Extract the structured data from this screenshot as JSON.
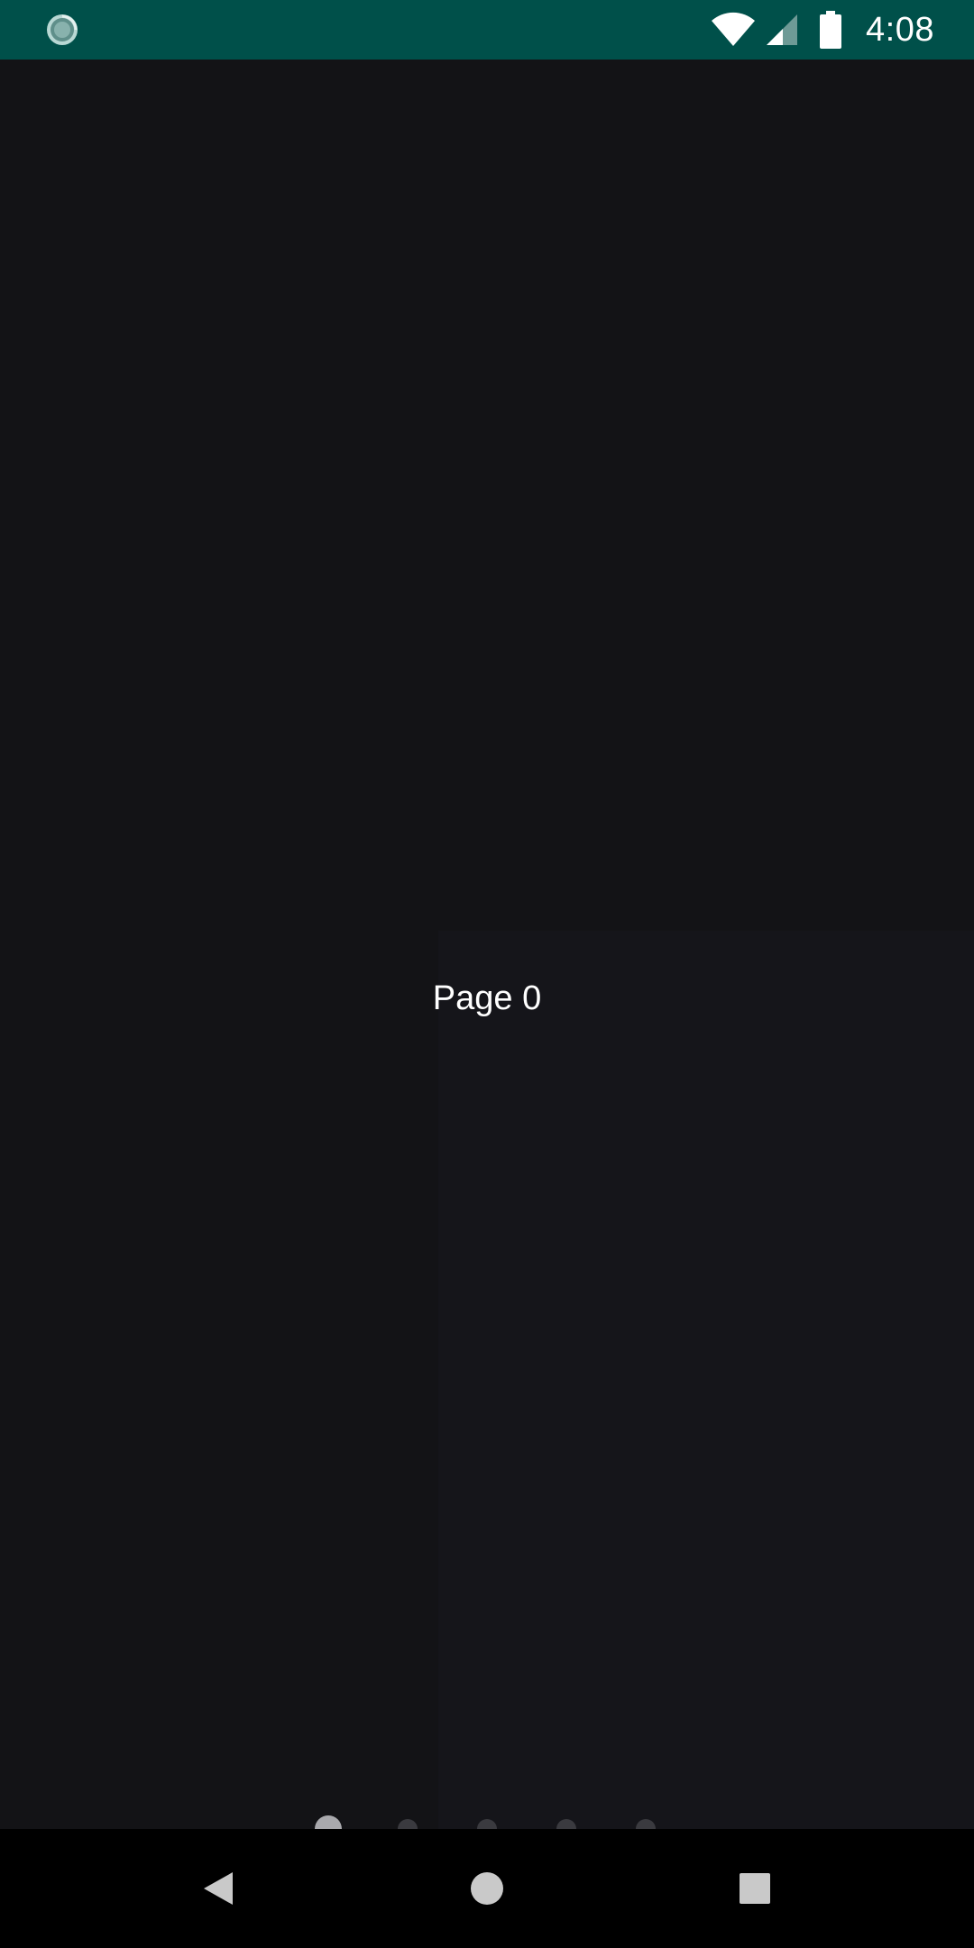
{
  "status_bar": {
    "time": "4:08",
    "icons": [
      "sync-icon",
      "wifi-icon",
      "signal-icon",
      "battery-icon"
    ],
    "background_color": "#00504a"
  },
  "main": {
    "page_label": "Page 0",
    "background_color": "#131316"
  },
  "page_indicator": {
    "total": 5,
    "active_index": 0
  },
  "nav_bar": {
    "buttons": [
      "back-icon",
      "home-icon",
      "recents-icon"
    ],
    "background_color": "#000000"
  }
}
